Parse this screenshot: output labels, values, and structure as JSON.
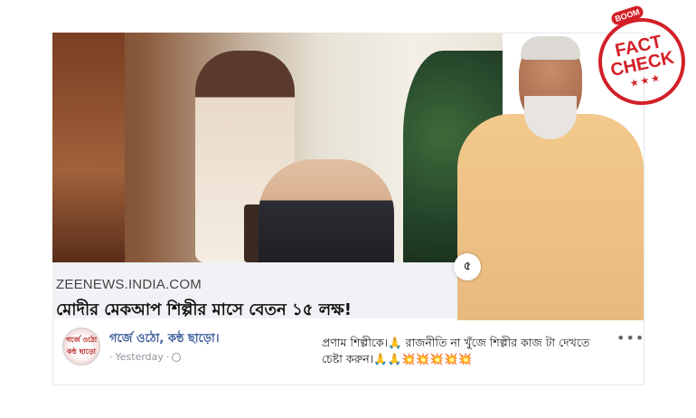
{
  "link_preview": {
    "domain": "ZEENEWS.INDIA.COM",
    "headline": "মোদীর মেকআপ শিল্পীর মাসে বেতন ১৫ লক্ষ!",
    "share_glyph": "৫"
  },
  "fact_check_stamp": {
    "brand": "BOOM",
    "line1": "FACT",
    "line2": "CHECK",
    "stars": "★★★",
    "color": "#d32027"
  },
  "post": {
    "page_name": "গর্জে ওঠো, কন্ঠ ছাড়ো।",
    "timestamp": "Yesterday",
    "separator": "·",
    "text": "প্রণাম শিল্পীকে।🙏 রাজনীতি না খুঁজে শিল্পীর কাজ টা দেখতে চেষ্টা করুন।🙏🙏💥💥💥💥💥",
    "more_glyph": "•••",
    "avatar_text": "গর্জে ওঠো কন্ঠ ছাড়ো"
  },
  "colors": {
    "link_name": "#385898",
    "meta": "#90949c",
    "linkbar_bg": "#f0f2f5"
  }
}
